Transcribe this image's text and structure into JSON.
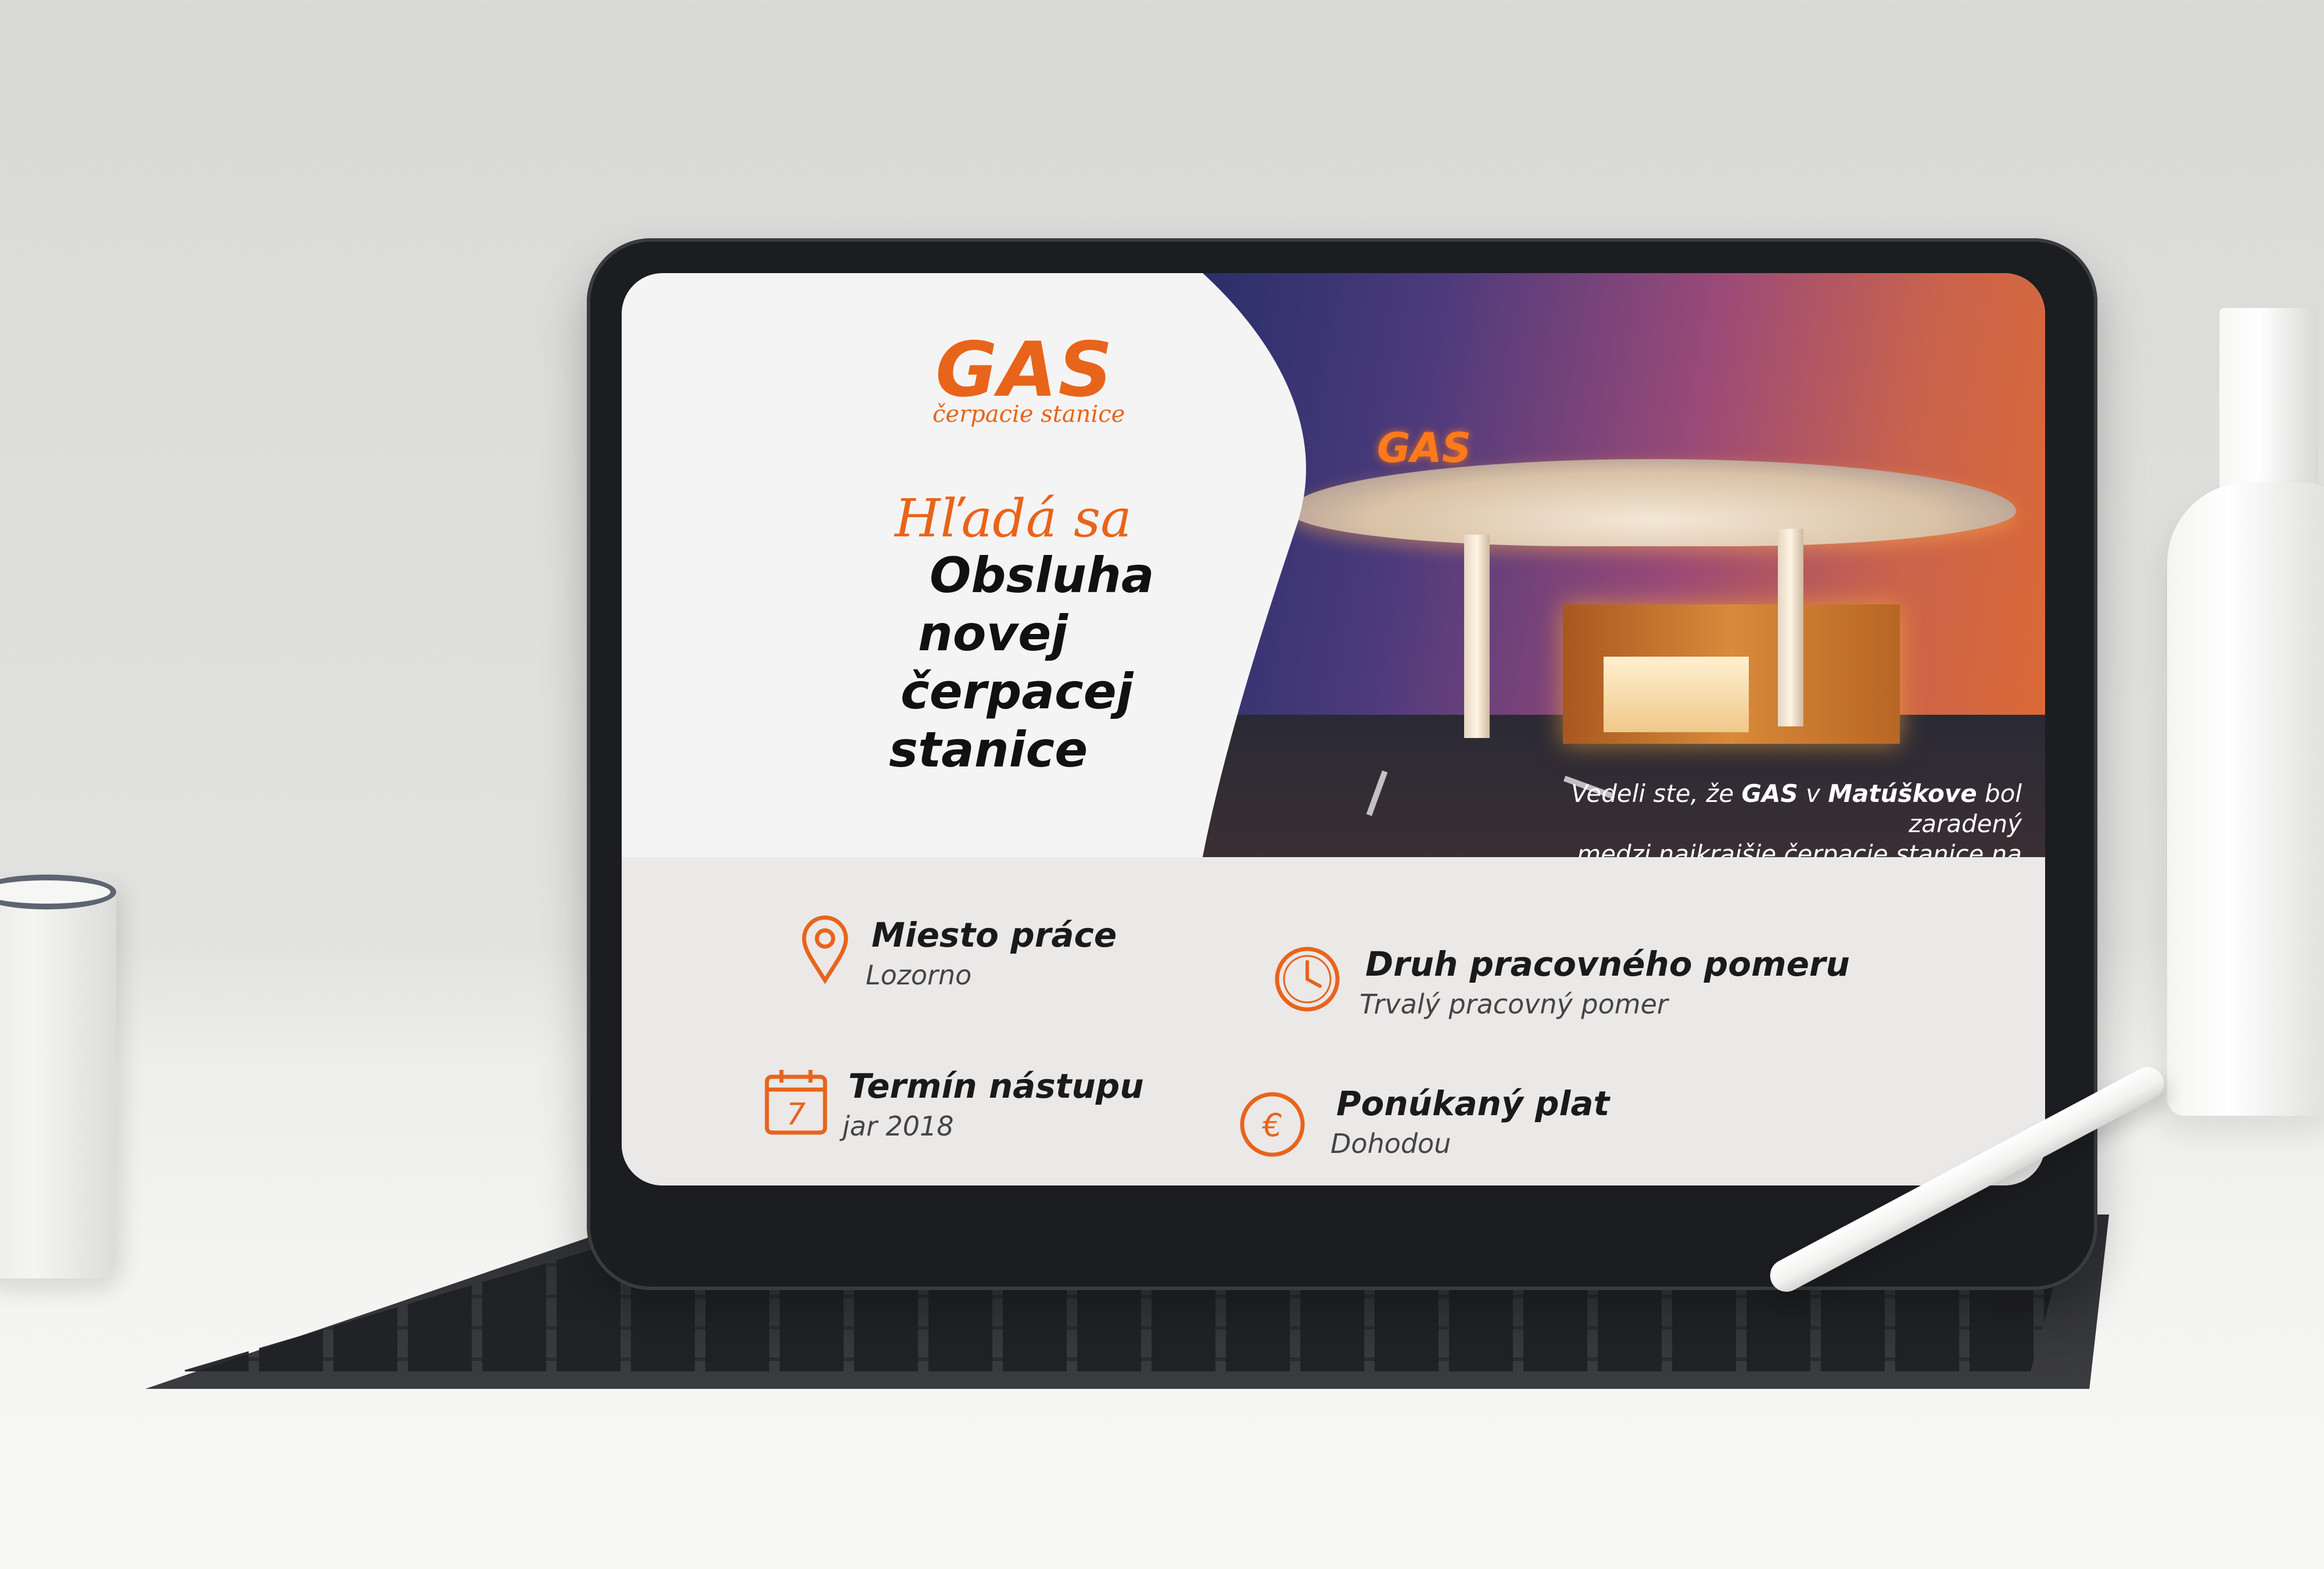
{
  "brand": {
    "logo": "GAS",
    "tagline": "čerpacie stanice",
    "accent_color": "#e8641a"
  },
  "hero": {
    "sign_text": "GAS",
    "fact_prefix": "Vedeli ste, že",
    "fact_brand": "GAS",
    "fact_mid": "v",
    "fact_place": "Matúškove",
    "fact_rest_line1": "bol zaradený",
    "fact_line2": "medzi najkrajšie čerpacie stanice na svete?"
  },
  "headline": {
    "kicker": "Hľadá sa",
    "lines": [
      "Obsluha",
      "novej",
      "čerpacej",
      "stanice"
    ]
  },
  "details": [
    {
      "title": "Miesto práce",
      "value": "Lozorno",
      "icon": "location-pin-icon"
    },
    {
      "title": "Druh pracovného pomeru",
      "value": "Trvalý pracovný pomer",
      "icon": "clock-icon"
    },
    {
      "title": "Termín nástupu",
      "value": "jar 2018",
      "icon": "calendar-icon",
      "icon_label": "7"
    },
    {
      "title": "Ponúkaný plat",
      "value": "Dohodou",
      "icon": "euro-icon",
      "icon_label": "€"
    }
  ]
}
